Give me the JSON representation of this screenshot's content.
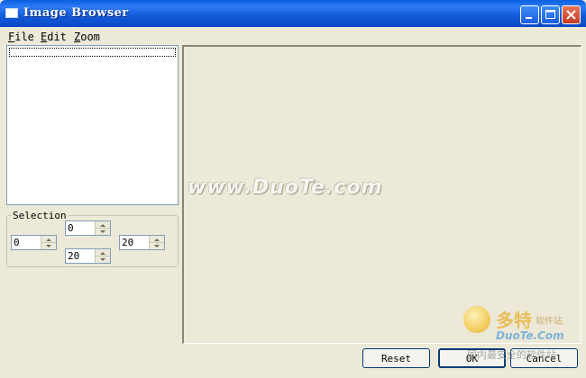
{
  "window": {
    "title": "Image Browser"
  },
  "menu": {
    "file": {
      "mnemonic": "F",
      "rest": "ile"
    },
    "edit": {
      "mnemonic": "E",
      "rest": "dit"
    },
    "zoom": {
      "mnemonic": "Z",
      "rest": "oom"
    }
  },
  "selection": {
    "label": "Selection",
    "left": "0",
    "top": "0",
    "right": "20",
    "bottom": "20"
  },
  "buttons": {
    "reset": "Reset",
    "ok": "OK",
    "cancel": "Cancel"
  },
  "watermarks": {
    "center": "www.DuoTe.com",
    "logo_main": "多特",
    "logo_sub": "软件站",
    "logo_url": "DuoTe.Com",
    "logo_tag": "国内最安全的软件站"
  },
  "colors": {
    "titlebar": "#0a5fe0",
    "face": "#ece9d8",
    "border": "#7f9db9"
  },
  "icons": {
    "app": "window-icon",
    "minimize": "minimize-icon",
    "maximize": "maximize-icon",
    "close": "close-icon"
  }
}
